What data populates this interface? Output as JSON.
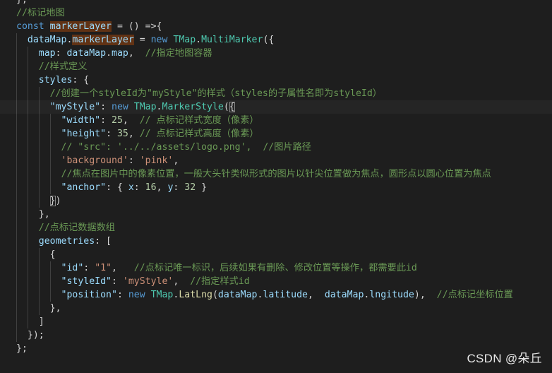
{
  "theme": {
    "background": "#1e1e1e",
    "default_text": "#d4d4d4",
    "keyword": "#569cd6",
    "variable": "#9cdcfe",
    "class_name": "#4ec9b0",
    "function": "#dcdcaa",
    "string": "#ce9178",
    "number": "#b5cea8",
    "comment": "#6a9955",
    "selection_highlight": "#613214"
  },
  "code": {
    "lines": [
      [
        {
          "t": "};",
          "c": "p"
        }
      ],
      [
        {
          "t": "//标记地图",
          "c": "cm"
        }
      ],
      [
        {
          "t": "const",
          "c": "kw"
        },
        {
          "t": " ",
          "c": "p"
        },
        {
          "t": "markerLayer",
          "c": "vr",
          "hl": true
        },
        {
          "t": " = () =>{",
          "c": "p"
        }
      ],
      [
        {
          "t": "  ",
          "c": "p"
        },
        {
          "t": "dataMap",
          "c": "vr"
        },
        {
          "t": ".",
          "c": "p"
        },
        {
          "t": "markerLayer",
          "c": "vr",
          "hl": true
        },
        {
          "t": " = ",
          "c": "p"
        },
        {
          "t": "new",
          "c": "kw"
        },
        {
          "t": " ",
          "c": "p"
        },
        {
          "t": "TMap",
          "c": "cl"
        },
        {
          "t": ".",
          "c": "p"
        },
        {
          "t": "MultiMarker",
          "c": "cl"
        },
        {
          "t": "({",
          "c": "p"
        }
      ],
      [
        {
          "t": "    ",
          "c": "p"
        },
        {
          "t": "map",
          "c": "vr"
        },
        {
          "t": ": ",
          "c": "p"
        },
        {
          "t": "dataMap",
          "c": "vr"
        },
        {
          "t": ".",
          "c": "p"
        },
        {
          "t": "map",
          "c": "vr"
        },
        {
          "t": ",  ",
          "c": "p"
        },
        {
          "t": "//指定地图容器",
          "c": "cm"
        }
      ],
      [
        {
          "t": "    ",
          "c": "p"
        },
        {
          "t": "//样式定义",
          "c": "cm"
        }
      ],
      [
        {
          "t": "    ",
          "c": "p"
        },
        {
          "t": "styles",
          "c": "vr"
        },
        {
          "t": ": {",
          "c": "p"
        }
      ],
      [
        {
          "t": "      ",
          "c": "p"
        },
        {
          "t": "//创建一个styleId为\"myStyle\"的样式（styles的子属性名即为styleId）",
          "c": "cm"
        }
      ],
      [
        {
          "t": "      ",
          "c": "p"
        },
        {
          "t": "\"myStyle\"",
          "c": "vr"
        },
        {
          "t": ": ",
          "c": "p"
        },
        {
          "t": "new",
          "c": "kw"
        },
        {
          "t": " ",
          "c": "p"
        },
        {
          "t": "TMap",
          "c": "cl"
        },
        {
          "t": ".",
          "c": "p"
        },
        {
          "t": "MarkerStyle",
          "c": "cl"
        },
        {
          "t": "(",
          "c": "p"
        },
        {
          "t": "{",
          "c": "p",
          "bm": true
        }
      ],
      [
        {
          "t": "        ",
          "c": "p"
        },
        {
          "t": "\"width\"",
          "c": "vr"
        },
        {
          "t": ": ",
          "c": "p"
        },
        {
          "t": "25",
          "c": "nm"
        },
        {
          "t": ",  ",
          "c": "p"
        },
        {
          "t": "// 点标记样式宽度（像素）",
          "c": "cm"
        }
      ],
      [
        {
          "t": "        ",
          "c": "p"
        },
        {
          "t": "\"height\"",
          "c": "vr"
        },
        {
          "t": ": ",
          "c": "p"
        },
        {
          "t": "35",
          "c": "nm"
        },
        {
          "t": ", ",
          "c": "p"
        },
        {
          "t": "// 点标记样式高度（像素）",
          "c": "cm"
        }
      ],
      [
        {
          "t": "        ",
          "c": "p"
        },
        {
          "t": "// \"src\": '../../assets/logo.png',  //图片路径",
          "c": "cm"
        }
      ],
      [
        {
          "t": "        ",
          "c": "p"
        },
        {
          "t": "'background'",
          "c": "st"
        },
        {
          "t": ": ",
          "c": "p"
        },
        {
          "t": "'pink'",
          "c": "st"
        },
        {
          "t": ",",
          "c": "p"
        }
      ],
      [
        {
          "t": "        ",
          "c": "p"
        },
        {
          "t": "//焦点在图片中的像素位置，一般大头针类似形式的图片以针尖位置做为焦点，圆形点以圆心位置为焦点",
          "c": "cm"
        }
      ],
      [
        {
          "t": "        ",
          "c": "p"
        },
        {
          "t": "\"anchor\"",
          "c": "vr"
        },
        {
          "t": ": { ",
          "c": "p"
        },
        {
          "t": "x",
          "c": "vr"
        },
        {
          "t": ": ",
          "c": "p"
        },
        {
          "t": "16",
          "c": "nm"
        },
        {
          "t": ", ",
          "c": "p"
        },
        {
          "t": "y",
          "c": "vr"
        },
        {
          "t": ": ",
          "c": "p"
        },
        {
          "t": "32",
          "c": "nm"
        },
        {
          "t": " }",
          "c": "p"
        }
      ],
      [
        {
          "t": "      ",
          "c": "p"
        },
        {
          "t": "}",
          "c": "p",
          "bm": true
        },
        {
          "t": ")",
          "c": "p"
        }
      ],
      [
        {
          "t": "    },",
          "c": "p"
        }
      ],
      [
        {
          "t": "    ",
          "c": "p"
        },
        {
          "t": "//点标记数据数组",
          "c": "cm"
        }
      ],
      [
        {
          "t": "    ",
          "c": "p"
        },
        {
          "t": "geometries",
          "c": "vr"
        },
        {
          "t": ": [",
          "c": "p"
        }
      ],
      [
        {
          "t": "      {",
          "c": "p"
        }
      ],
      [
        {
          "t": "        ",
          "c": "p"
        },
        {
          "t": "\"id\"",
          "c": "vr"
        },
        {
          "t": ": ",
          "c": "p"
        },
        {
          "t": "\"1\"",
          "c": "st"
        },
        {
          "t": ",   ",
          "c": "p"
        },
        {
          "t": "//点标记唯一标识，后续如果有删除、修改位置等操作，都需要此id",
          "c": "cm"
        }
      ],
      [
        {
          "t": "        ",
          "c": "p"
        },
        {
          "t": "\"styleId\"",
          "c": "vr"
        },
        {
          "t": ": ",
          "c": "p"
        },
        {
          "t": "'myStyle'",
          "c": "st"
        },
        {
          "t": ",  ",
          "c": "p"
        },
        {
          "t": "//指定样式id",
          "c": "cm"
        }
      ],
      [
        {
          "t": "        ",
          "c": "p"
        },
        {
          "t": "\"position\"",
          "c": "vr"
        },
        {
          "t": ": ",
          "c": "p"
        },
        {
          "t": "new",
          "c": "kw"
        },
        {
          "t": " ",
          "c": "p"
        },
        {
          "t": "TMap",
          "c": "cl"
        },
        {
          "t": ".",
          "c": "p"
        },
        {
          "t": "LatLng",
          "c": "fn"
        },
        {
          "t": "(",
          "c": "p"
        },
        {
          "t": "dataMap",
          "c": "vr"
        },
        {
          "t": ".",
          "c": "p"
        },
        {
          "t": "latitude",
          "c": "vr"
        },
        {
          "t": ",  ",
          "c": "p"
        },
        {
          "t": "dataMap",
          "c": "vr"
        },
        {
          "t": ".",
          "c": "p"
        },
        {
          "t": "lngitude",
          "c": "vr"
        },
        {
          "t": "),  ",
          "c": "p"
        },
        {
          "t": "//点标记坐标位置",
          "c": "cm"
        }
      ],
      [
        {
          "t": "      },",
          "c": "p"
        }
      ],
      [
        {
          "t": "    ]",
          "c": "p"
        }
      ],
      [
        {
          "t": "  });",
          "c": "p"
        }
      ],
      [
        {
          "t": "};",
          "c": "p"
        }
      ]
    ]
  },
  "watermark": "CSDN @朵丘"
}
